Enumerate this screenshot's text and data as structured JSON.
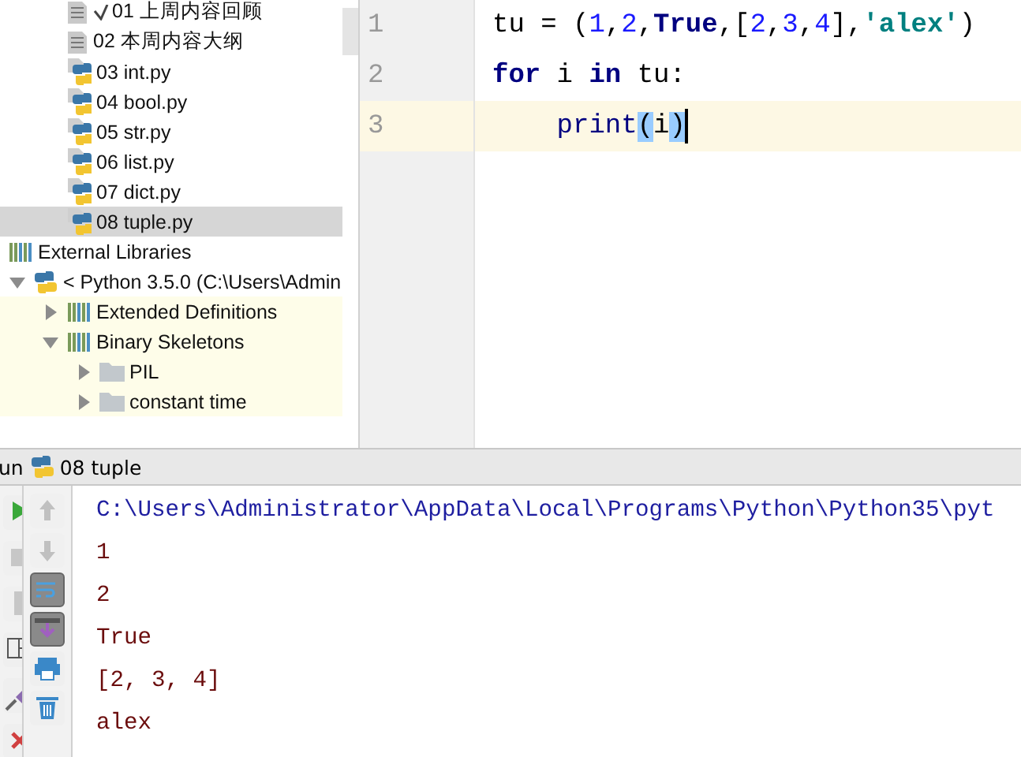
{
  "project_files": [
    {
      "label": "01 上周内容回顾",
      "kind": "text-file",
      "checked": true,
      "selected": false
    },
    {
      "label": "02 本周内容大纲",
      "kind": "text-file",
      "checked": false,
      "selected": false
    },
    {
      "label": "03 int.py",
      "kind": "python-file",
      "checked": false,
      "selected": false
    },
    {
      "label": "04 bool.py",
      "kind": "python-file",
      "checked": false,
      "selected": false
    },
    {
      "label": "05 str.py",
      "kind": "python-file",
      "checked": false,
      "selected": false
    },
    {
      "label": "06 list.py",
      "kind": "python-file",
      "checked": false,
      "selected": false
    },
    {
      "label": "07 dict.py",
      "kind": "python-file",
      "checked": false,
      "selected": false
    },
    {
      "label": "08 tuple.py",
      "kind": "python-file",
      "checked": false,
      "selected": true
    }
  ],
  "external_libraries": {
    "label": "External Libraries",
    "children": [
      {
        "label": "< Python 3.5.0 (C:\\Users\\Admin",
        "kind": "sdk",
        "expanded": true,
        "children": [
          {
            "label": "Extended Definitions",
            "kind": "library",
            "expanded": false
          },
          {
            "label": "Binary Skeletons",
            "kind": "library",
            "expanded": true,
            "children": [
              {
                "label": "PIL",
                "kind": "folder",
                "expanded": false
              },
              {
                "label": "constant time",
                "kind": "folder",
                "expanded": false
              }
            ]
          }
        ]
      }
    ]
  },
  "editor": {
    "lines": [
      {
        "number": "1",
        "current": false,
        "tokens": [
          {
            "text": "tu = (",
            "kind": "plain"
          },
          {
            "text": "1",
            "kind": "number"
          },
          {
            "text": ",",
            "kind": "plain"
          },
          {
            "text": "2",
            "kind": "number"
          },
          {
            "text": ",",
            "kind": "plain"
          },
          {
            "text": "True",
            "kind": "keyword"
          },
          {
            "text": ",[",
            "kind": "plain"
          },
          {
            "text": "2",
            "kind": "number"
          },
          {
            "text": ",",
            "kind": "plain"
          },
          {
            "text": "3",
            "kind": "number"
          },
          {
            "text": ",",
            "kind": "plain"
          },
          {
            "text": "4",
            "kind": "number"
          },
          {
            "text": "],",
            "kind": "plain"
          },
          {
            "text": "'alex'",
            "kind": "string"
          },
          {
            "text": ")",
            "kind": "plain"
          }
        ]
      },
      {
        "number": "2",
        "current": false,
        "tokens": [
          {
            "text": "for",
            "kind": "keyword"
          },
          {
            "text": " i ",
            "kind": "plain"
          },
          {
            "text": "in",
            "kind": "keyword"
          },
          {
            "text": " tu:",
            "kind": "plain"
          }
        ]
      },
      {
        "number": "3",
        "current": true,
        "tokens": [
          {
            "text": "    print",
            "kind": "builtin"
          },
          {
            "text": "(",
            "kind": "match"
          },
          {
            "text": "i",
            "kind": "plain"
          },
          {
            "text": ")",
            "kind": "match"
          }
        ]
      }
    ]
  },
  "run_panel": {
    "title": "un",
    "tab": "08 tuple",
    "left_tools": [
      {
        "kind": "run",
        "disabled": false
      },
      {
        "kind": "stop",
        "disabled": true
      },
      {
        "kind": "pause",
        "disabled": true
      },
      {
        "kind": "layout",
        "disabled": false
      },
      {
        "kind": "pin",
        "disabled": false
      },
      {
        "kind": "close",
        "disabled": false
      }
    ],
    "tools": [
      {
        "kind": "up",
        "disabled": true,
        "on": false
      },
      {
        "kind": "down",
        "disabled": true,
        "on": false
      },
      {
        "kind": "wrap",
        "disabled": false,
        "on": true
      },
      {
        "kind": "scroll-end",
        "disabled": false,
        "on": true
      },
      {
        "kind": "print",
        "disabled": false,
        "on": false
      },
      {
        "kind": "trash",
        "disabled": false,
        "on": false
      }
    ],
    "output": [
      {
        "text": "C:\\Users\\Administrator\\AppData\\Local\\Programs\\Python\\Python35\\pyt",
        "kind": "command"
      },
      {
        "text": "1",
        "kind": "stdout"
      },
      {
        "text": "2",
        "kind": "stdout"
      },
      {
        "text": "True",
        "kind": "stdout"
      },
      {
        "text": "[2, 3, 4]",
        "kind": "stdout"
      },
      {
        "text": "alex",
        "kind": "stdout"
      }
    ]
  }
}
